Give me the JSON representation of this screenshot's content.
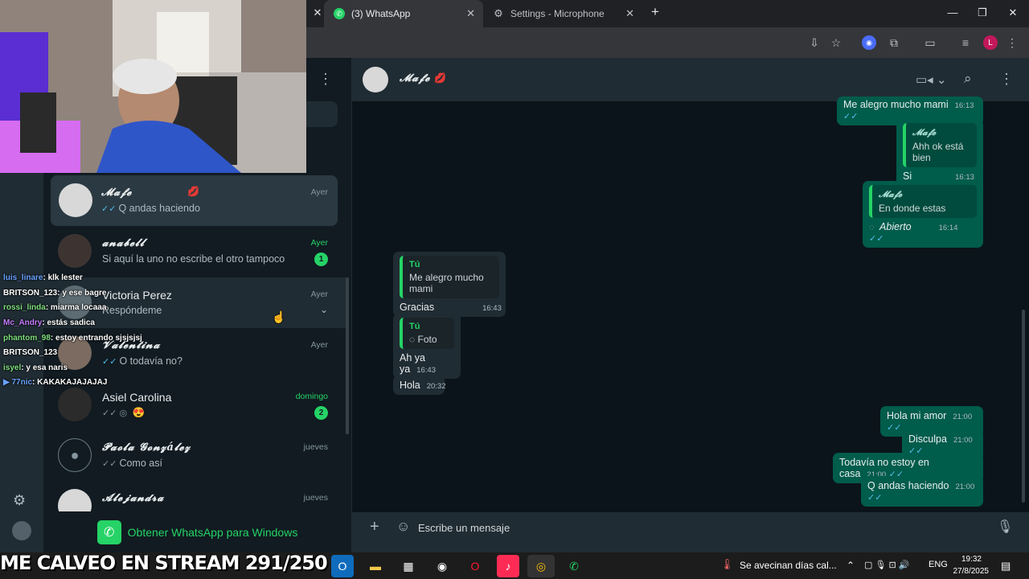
{
  "browser": {
    "tabs": [
      {
        "label": "(3) WhatsApp"
      },
      {
        "label": "Settings - Microphone"
      }
    ],
    "profile_initial": "L"
  },
  "sidebar": {
    "chats": [
      {
        "name": "𝓜𝓪𝓯𝓮",
        "preview": "Q andas haciendo",
        "time": "Ayer",
        "checks": "✓✓"
      },
      {
        "name": "𝓪𝓷𝓪𝓫𝓮𝓵𝓵",
        "preview": "Si aquí la uno no escribe el otro tampoco",
        "time": "Ayer",
        "badge": "1"
      },
      {
        "name": "Victoria Perez",
        "preview": "Respóndeme",
        "time": "Ayer"
      },
      {
        "name": "𝓥𝓪𝓵𝓮𝓷𝓽𝓲𝓷𝓪",
        "preview": "O todavía no?",
        "time": "Ayer",
        "checks": "✓✓"
      },
      {
        "name": "Asiel Carolina",
        "preview": "😍",
        "time": "domingo",
        "badge": "2",
        "checks": "✓✓"
      },
      {
        "name": "𝓟𝓪𝓸𝓵𝓪 𝓖𝓸𝓷𝔃á𝓵𝓮𝔃",
        "preview": "Como así",
        "time": "jueves",
        "checks": "✓✓"
      },
      {
        "name": "𝓐𝓵𝓮𝓳𝓪𝓷𝓭𝓻𝓪",
        "preview": "",
        "time": "jueves"
      }
    ],
    "get_app": "Obtener WhatsApp para Windows"
  },
  "conversation": {
    "contact": "𝓜𝓪𝓯𝓮",
    "messages": [
      {
        "dir": "out",
        "text": "Me alegro mucho mami",
        "time": "16:13"
      },
      {
        "dir": "out",
        "quote_name": "𝓜𝓪𝓯𝓮",
        "quote_text": "Ahh ok está bien",
        "text": "Si",
        "time": "16:13"
      },
      {
        "dir": "out",
        "quote_name": "𝓜𝓪𝓯𝓮",
        "quote_text": "En donde estas",
        "text": "Abierto",
        "time": "16:14"
      },
      {
        "dir": "in",
        "quote_name": "Tú",
        "quote_text": "Me alegro mucho mami",
        "text": "Gracias",
        "time": "16:43"
      },
      {
        "dir": "in",
        "quote_name": "Tú",
        "quote_text": "Foto",
        "text": "Ah ya ya",
        "time": "16:43"
      },
      {
        "dir": "in",
        "text": "Hola",
        "time": "20:32"
      },
      {
        "dir": "out",
        "text": "Hola mi amor",
        "time": "21:00"
      },
      {
        "dir": "out",
        "text": "Disculpa",
        "time": "21:00"
      },
      {
        "dir": "out",
        "text": "Todavía no estoy en casa",
        "time": "21:00"
      },
      {
        "dir": "out",
        "text": "Q andas haciendo",
        "time": "21:00"
      }
    ],
    "composer_placeholder": "Escribe un mensaje"
  },
  "stream": {
    "chat": [
      {
        "user": "luis_linare",
        "color": "#6aa2ff",
        "msg": ": klk lester"
      },
      {
        "user": "BRITSON_123",
        "color": "#ffffff",
        "msg": ": y ese bagre"
      },
      {
        "user": "rossi_linda",
        "color": "#7ee07e",
        "msg": ": miarma locaaa"
      },
      {
        "user": "Mc_Andry",
        "color": "#c77dff",
        "msg": ": estás sadica"
      },
      {
        "user": "phantom_98",
        "color": "#7ee07e",
        "msg": ": estoy entrando sjsjsjsj"
      },
      {
        "user": "BRITSON_123",
        "color": "#ffffff",
        "msg": ""
      },
      {
        "user": "isyel",
        "color": "#7ee07e",
        "msg": ": y esa naris"
      },
      {
        "user": "77nic",
        "color": "#6aa2ff",
        "msg": ": KAKAKAJAJAJAJ"
      }
    ],
    "title": "ME CALVEO EN STREAM 291/250"
  },
  "taskbar": {
    "weather": "Se avecinan días cal...",
    "lang": "ENG",
    "time": "19:32",
    "date": "27/8/2025"
  },
  "colors": {
    "accent": "#25d366",
    "outgoing": "#005c4b",
    "incoming": "#202c33"
  }
}
